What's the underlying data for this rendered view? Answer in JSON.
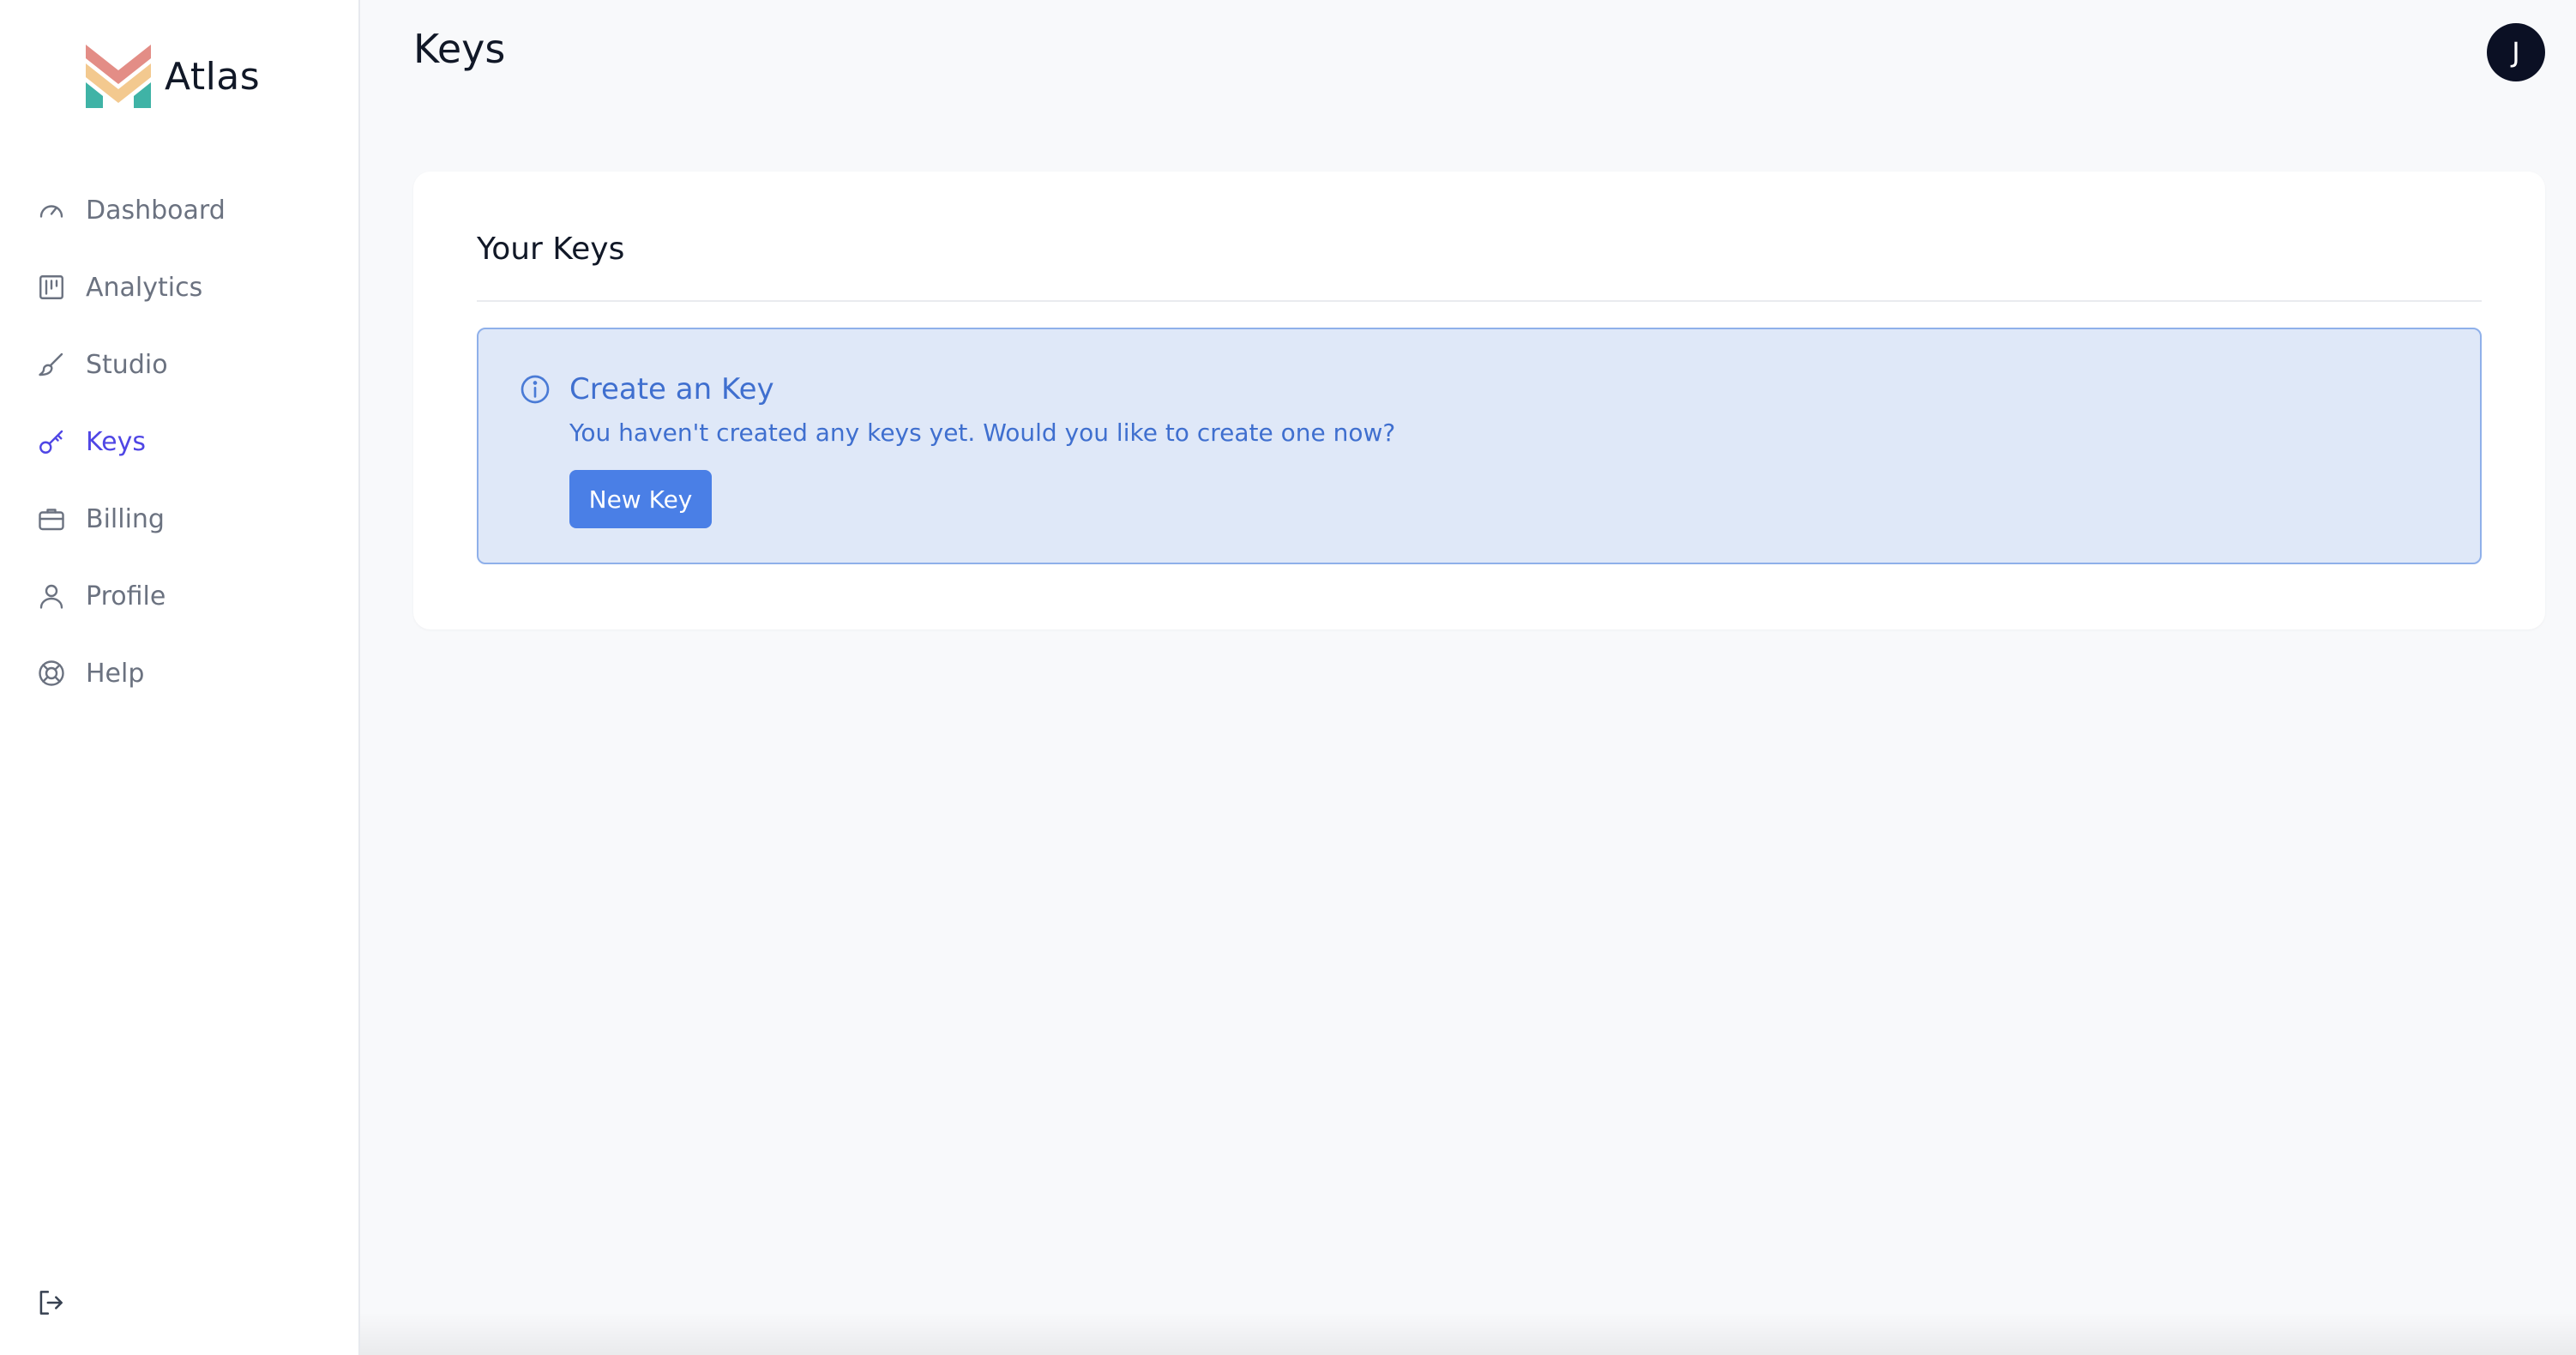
{
  "brand": {
    "name": "Atlas"
  },
  "sidebar": {
    "items": [
      {
        "label": "Dashboard",
        "icon": "speedometer-icon",
        "active": false
      },
      {
        "label": "Analytics",
        "icon": "bar-chart-icon",
        "active": false
      },
      {
        "label": "Studio",
        "icon": "brush-icon",
        "active": false
      },
      {
        "label": "Keys",
        "icon": "key-icon",
        "active": true
      },
      {
        "label": "Billing",
        "icon": "briefcase-icon",
        "active": false
      },
      {
        "label": "Profile",
        "icon": "user-icon",
        "active": false
      },
      {
        "label": "Help",
        "icon": "lifebuoy-icon",
        "active": false
      }
    ],
    "logout_icon": "logout-icon"
  },
  "header": {
    "title": "Keys",
    "avatar_initial": "J"
  },
  "card": {
    "title": "Your Keys",
    "alert": {
      "title": "Create an Key",
      "text": "You haven't created any keys yet. Would you like to create one now?",
      "button_label": "New Key",
      "icon": "info-icon"
    }
  },
  "colors": {
    "accent": "#4f46e5",
    "alert_text": "#3f6fcf",
    "alert_bg": "#dfe8f8",
    "button_bg": "#4a7fe6",
    "avatar_bg": "#0b1024"
  }
}
